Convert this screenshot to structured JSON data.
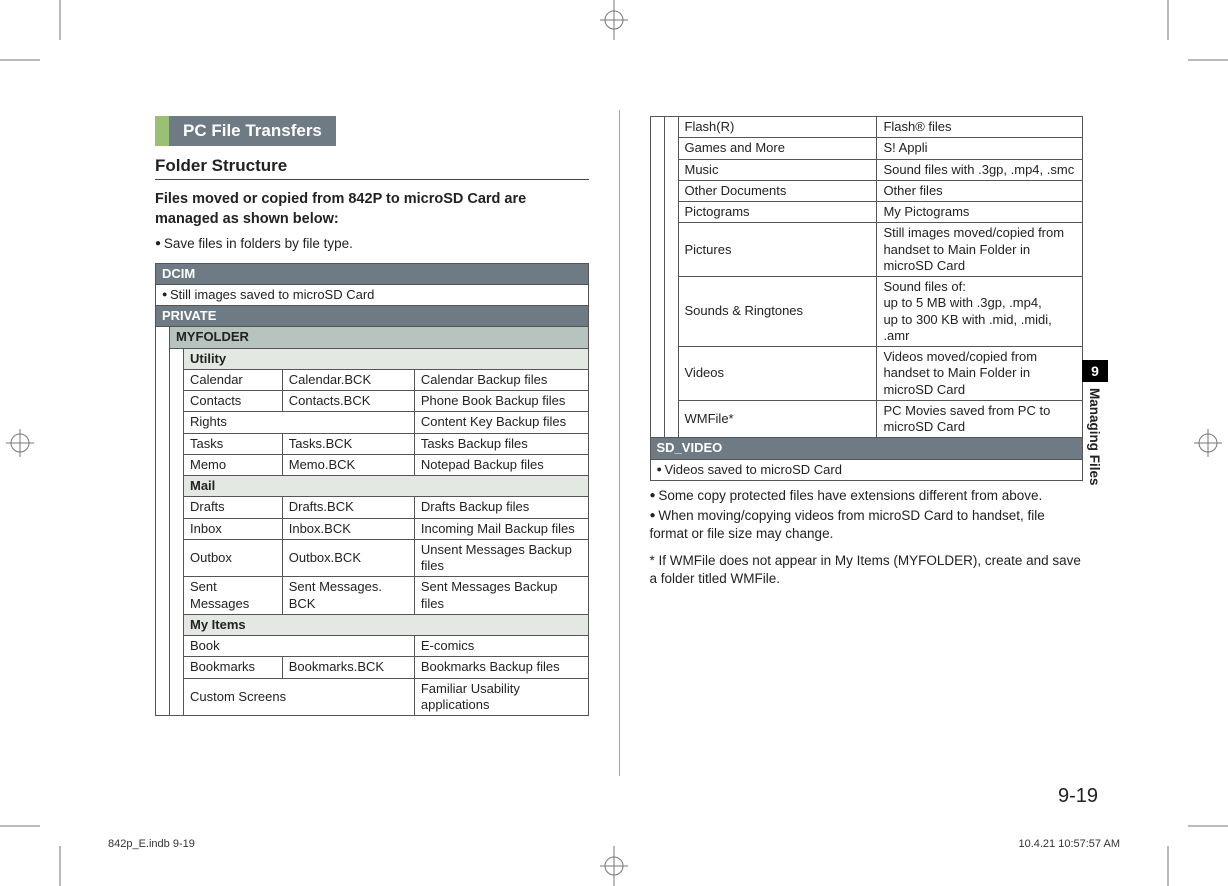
{
  "section_title": "PC File Transfers",
  "subhead": "Folder Structure",
  "intro_bold": "Files moved or copied from 842P to microSD Card are managed as shown below:",
  "intro_bullet": "Save files in folders by file type.",
  "left": {
    "dcim": "DCIM",
    "dcim_desc": "Still images saved to microSD Card",
    "private": "PRIVATE",
    "myfolder": "MYFOLDER",
    "utility": "Utility",
    "utility_rows": [
      {
        "a": "Calendar",
        "b": "Calendar.BCK",
        "c": "Calendar Backup files"
      },
      {
        "a": "Contacts",
        "b": "Contacts.BCK",
        "c": "Phone Book Backup files"
      },
      {
        "a": "Rights",
        "b": "",
        "c": "Content Key Backup files"
      },
      {
        "a": "Tasks",
        "b": "Tasks.BCK",
        "c": "Tasks Backup files"
      },
      {
        "a": "Memo",
        "b": "Memo.BCK",
        "c": "Notepad Backup files"
      }
    ],
    "mail": "Mail",
    "mail_rows": [
      {
        "a": "Drafts",
        "b": "Drafts.BCK",
        "c": "Drafts Backup files"
      },
      {
        "a": "Inbox",
        "b": "Inbox.BCK",
        "c": "Incoming Mail Backup files"
      },
      {
        "a": "Outbox",
        "b": "Outbox.BCK",
        "c": "Unsent Messages Backup files"
      },
      {
        "a": "Sent Messages",
        "b": "Sent Messages. BCK",
        "c": "Sent Messages Backup files"
      }
    ],
    "myitems": "My Items",
    "myitems_rows": [
      {
        "a": "Book",
        "b": "",
        "c": "E-comics"
      },
      {
        "a": "Bookmarks",
        "b": "Bookmarks.BCK",
        "c": "Bookmarks Backup files"
      },
      {
        "a": "Custom Screens",
        "b": "",
        "c": "Familiar Usability applications"
      }
    ]
  },
  "right": {
    "rows": [
      {
        "a": "Flash(R)",
        "c": "Flash® files"
      },
      {
        "a": "Games and More",
        "c": "S! Appli"
      },
      {
        "a": "Music",
        "c": "Sound files with .3gp, .mp4, .smc"
      },
      {
        "a": "Other Documents",
        "c": "Other files"
      },
      {
        "a": "Pictograms",
        "c": "My Pictograms"
      },
      {
        "a": "Pictures",
        "c": "Still images moved/copied from handset to Main Folder in microSD Card"
      },
      {
        "a": "Sounds & Ringtones",
        "c": "Sound files of:\nup to 5 MB with .3gp, .mp4,\nup to 300 KB with .mid, .midi, .amr"
      },
      {
        "a": "Videos",
        "c": "Videos moved/copied from handset to Main Folder in microSD Card"
      },
      {
        "a": "WMFile*",
        "c": "PC Movies saved from PC to microSD Card"
      }
    ],
    "sdvideo": "SD_VIDEO",
    "sdvideo_desc": "Videos saved to microSD Card",
    "notes": [
      "Some copy protected files have extensions different from above.",
      "When moving/copying videos from microSD Card to handset, file format or file size may change."
    ],
    "star_note": "* If WMFile does not appear in My Items (MYFOLDER), create and save a folder titled WMFile."
  },
  "sidetab_num": "9",
  "sidetab_label": "Managing Files",
  "pagenum": "9-19",
  "footer_left": "842p_E.indb   9-19",
  "footer_right": "10.4.21   10:57:57 AM"
}
